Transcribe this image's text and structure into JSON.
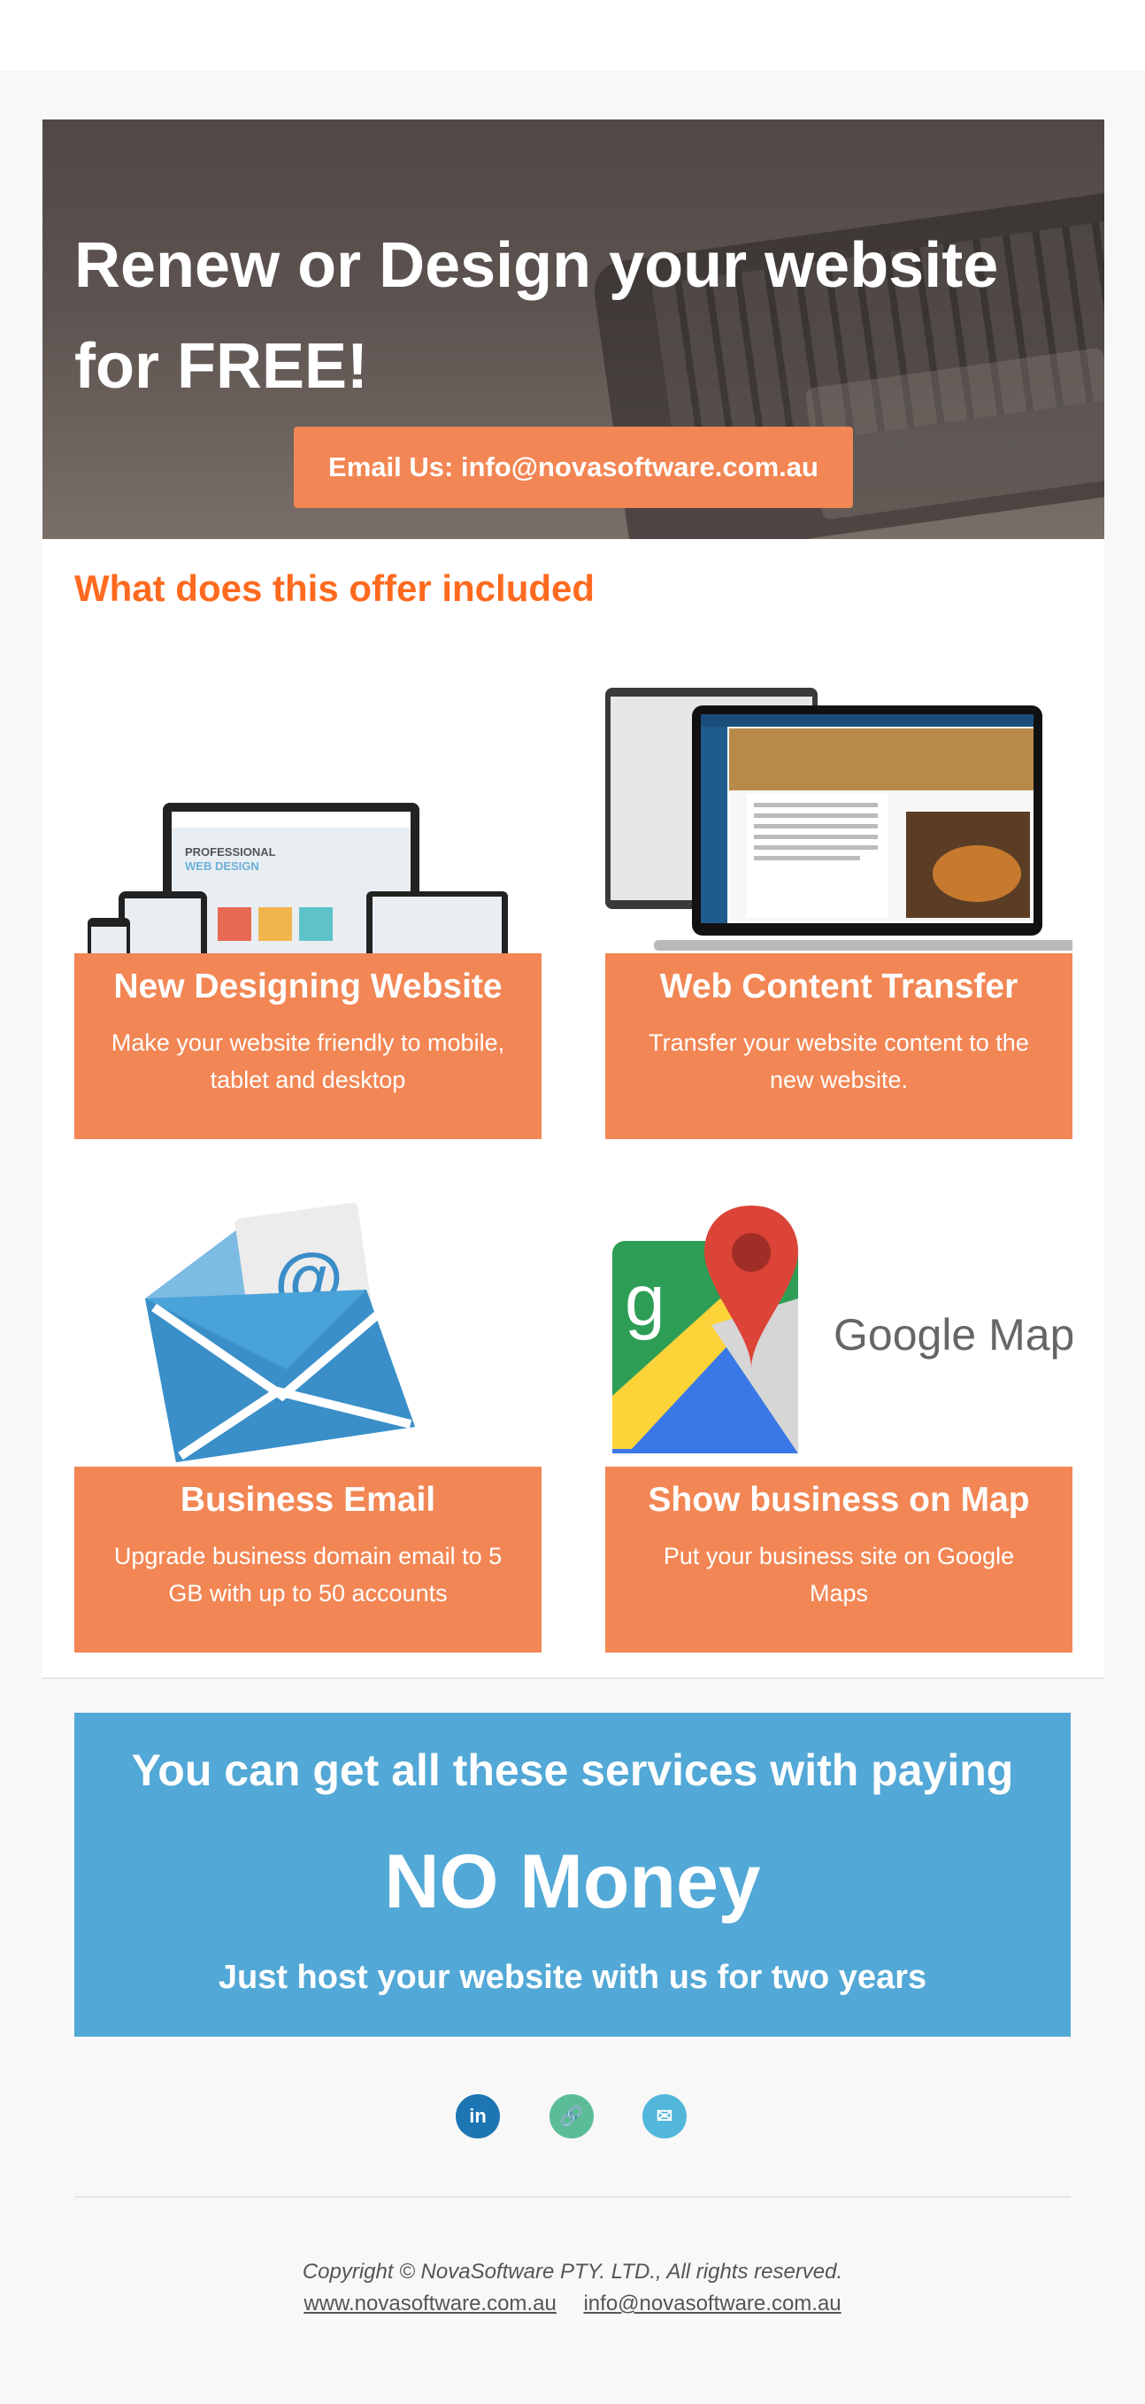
{
  "hero": {
    "headline": "Renew or Design your website for FREE!",
    "cta_label": "Email Us: info@novasoftware.com.au"
  },
  "section_title": "What does this offer included",
  "features": [
    {
      "icon": "devices-image",
      "title": "New Designing Website",
      "description": "Make your website friendly to mobile, tablet and desktop"
    },
    {
      "icon": "laptop-screenshot-image",
      "title": "Web Content Transfer",
      "description": "Transfer your website content to the new website."
    },
    {
      "icon": "email-envelope-image",
      "title": "Business Email",
      "description": "Upgrade business domain email to 5 GB with up to 50 accounts"
    },
    {
      "icon": "google-maps-logo",
      "title": "Show business on Map",
      "description": "Put your business site on Google Maps",
      "logo_text": "Google Maps"
    }
  ],
  "promo": {
    "line1": "You can get all these services with paying",
    "line2": "NO Money",
    "line3": "Just host your website with us for two years"
  },
  "social": [
    {
      "icon": "linkedin-icon",
      "glyph": "in"
    },
    {
      "icon": "link-icon",
      "glyph": "🔗"
    },
    {
      "icon": "mail-icon",
      "glyph": "✉"
    }
  ],
  "footer": {
    "copyright": "Copyright © NovaSoftware PTY. LTD., All rights reserved.",
    "website_link": "www.novasoftware.com.au",
    "email_link": "info@novasoftware.com.au"
  },
  "colors": {
    "accent": "#f28654",
    "title_orange": "#ff6a1f",
    "promo_blue": "#52a8d6"
  }
}
